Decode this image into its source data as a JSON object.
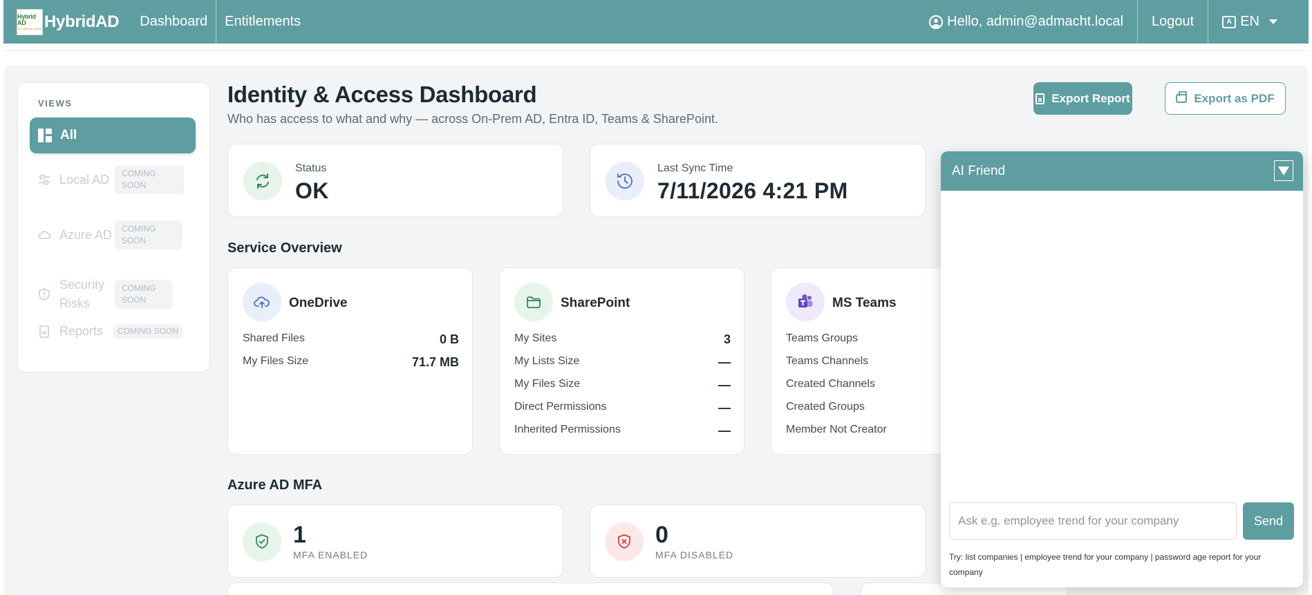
{
  "navbar": {
    "logo_line1": "Hybrid AD",
    "logo_line2": "Wir Machen Hybrid",
    "brand": "HybridAD",
    "links": [
      "Dashboard",
      "Entitlements"
    ],
    "greeting": "Hello, admin@admacht.local",
    "logout": "Logout",
    "language": "EN",
    "bg_color": "#5f9ea0"
  },
  "sidebar": {
    "title": "VIEWS",
    "active": "All",
    "items": [
      {
        "label": "Local AD",
        "badge": "COMING SOON",
        "icon": "sliders-icon"
      },
      {
        "label": "Azure AD",
        "badge": "COMING SOON",
        "icon": "cloud-icon"
      },
      {
        "label": "Security Risks",
        "badge": "COMING SOON",
        "icon": "shield-icon"
      },
      {
        "label": "Reports",
        "badge": "COMING SOON",
        "icon": "report-icon"
      }
    ]
  },
  "header": {
    "title": "Identity & Access Dashboard",
    "subtitle": "Who has access to what and why — across On-Prem AD, Entra ID, Teams & SharePoint.",
    "export_report": "Export Report",
    "export_pdf": "Export as PDF"
  },
  "status": {
    "label": "Status",
    "value": "OK",
    "sync_label": "Last Sync Time",
    "sync_value": "7/11/2026 4:21 PM"
  },
  "services": {
    "title": "Service Overview",
    "onedrive": {
      "name": "OneDrive",
      "rows": [
        {
          "label": "Shared Files",
          "value": "0 B"
        },
        {
          "label": "My Files Size",
          "value": "71.7 MB"
        }
      ]
    },
    "sharepoint": {
      "name": "SharePoint",
      "rows": [
        {
          "label": "My Sites",
          "value": "3"
        },
        {
          "label": "My Lists Size",
          "value": "—"
        },
        {
          "label": "My Files Size",
          "value": "—"
        },
        {
          "label": "Direct Permissions",
          "value": "—"
        },
        {
          "label": "Inherited Permissions",
          "value": "—"
        }
      ]
    },
    "teams": {
      "name": "MS Teams",
      "rows": [
        "Teams Groups",
        "Teams Channels",
        "Created Channels",
        "Created Groups",
        "Member Not Creator"
      ]
    }
  },
  "mfa": {
    "title": "Azure AD MFA",
    "enabled_value": "1",
    "enabled_label": "MFA ENABLED",
    "disabled_value": "0",
    "disabled_label": "MFA DISABLED"
  },
  "ai": {
    "title": "AI Friend",
    "placeholder": "Ask e.g. employee trend for your company",
    "send": "Send",
    "hint": "Try: list companies | employee trend for your company | password age report for your company"
  }
}
